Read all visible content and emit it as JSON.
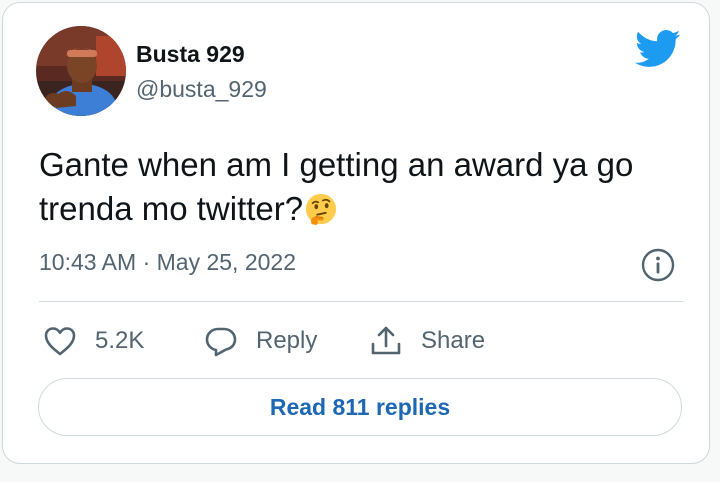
{
  "author": {
    "name": "Busta 929",
    "handle": "@busta_929"
  },
  "tweet": {
    "text": "Gante when am I getting an award ya go trenda mo twitter?",
    "emoji": "thinking-face",
    "timestamp": "10:43 AM · May 25, 2022"
  },
  "actions": {
    "likes": "5.2K",
    "reply_label": "Reply",
    "share_label": "Share"
  },
  "read_replies_label": "Read 811 replies",
  "colors": {
    "twitter_blue": "#1d9bf0",
    "link_blue": "#1d67b3",
    "text": "#0f1419",
    "muted": "#536471",
    "border": "#cfd9de"
  },
  "icons": [
    "twitter-bird-icon",
    "info-icon",
    "heart-icon",
    "reply-bubble-icon",
    "share-icon",
    "thinking-face-emoji"
  ]
}
